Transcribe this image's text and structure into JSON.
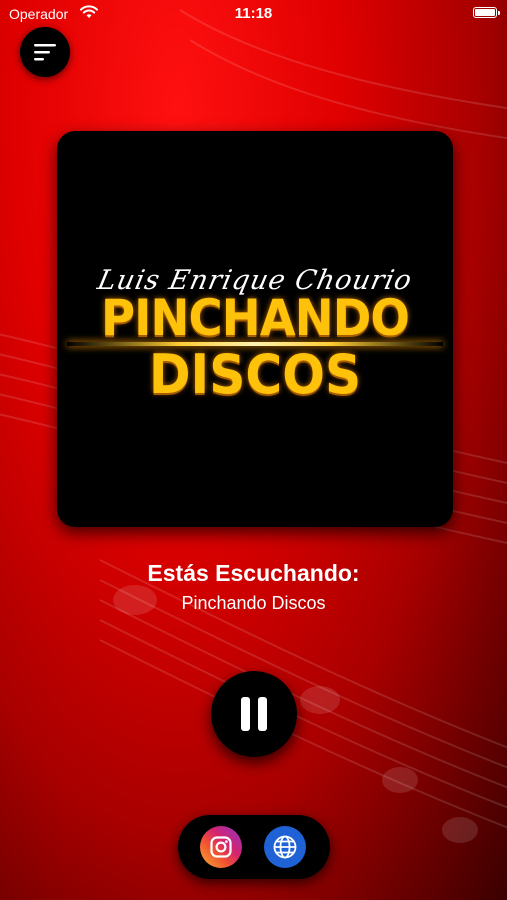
{
  "status_bar": {
    "carrier": "Operador",
    "time": "11:18"
  },
  "album_art": {
    "script_text": "Luis Enrique Chourio",
    "line1": "PINCHANDO",
    "line2": "DISCOS"
  },
  "now_playing": {
    "title": "Estás Escuchando:",
    "station": "Pinchando Discos"
  },
  "controls": {
    "play_state": "playing",
    "button_icon": "pause-icon"
  },
  "social": {
    "icons": [
      "instagram-icon",
      "globe-icon"
    ]
  },
  "colors": {
    "background": "#e00000",
    "logo_gold": "#ffc20a",
    "button_bg": "#000000",
    "web_blue": "#1f62d6"
  }
}
